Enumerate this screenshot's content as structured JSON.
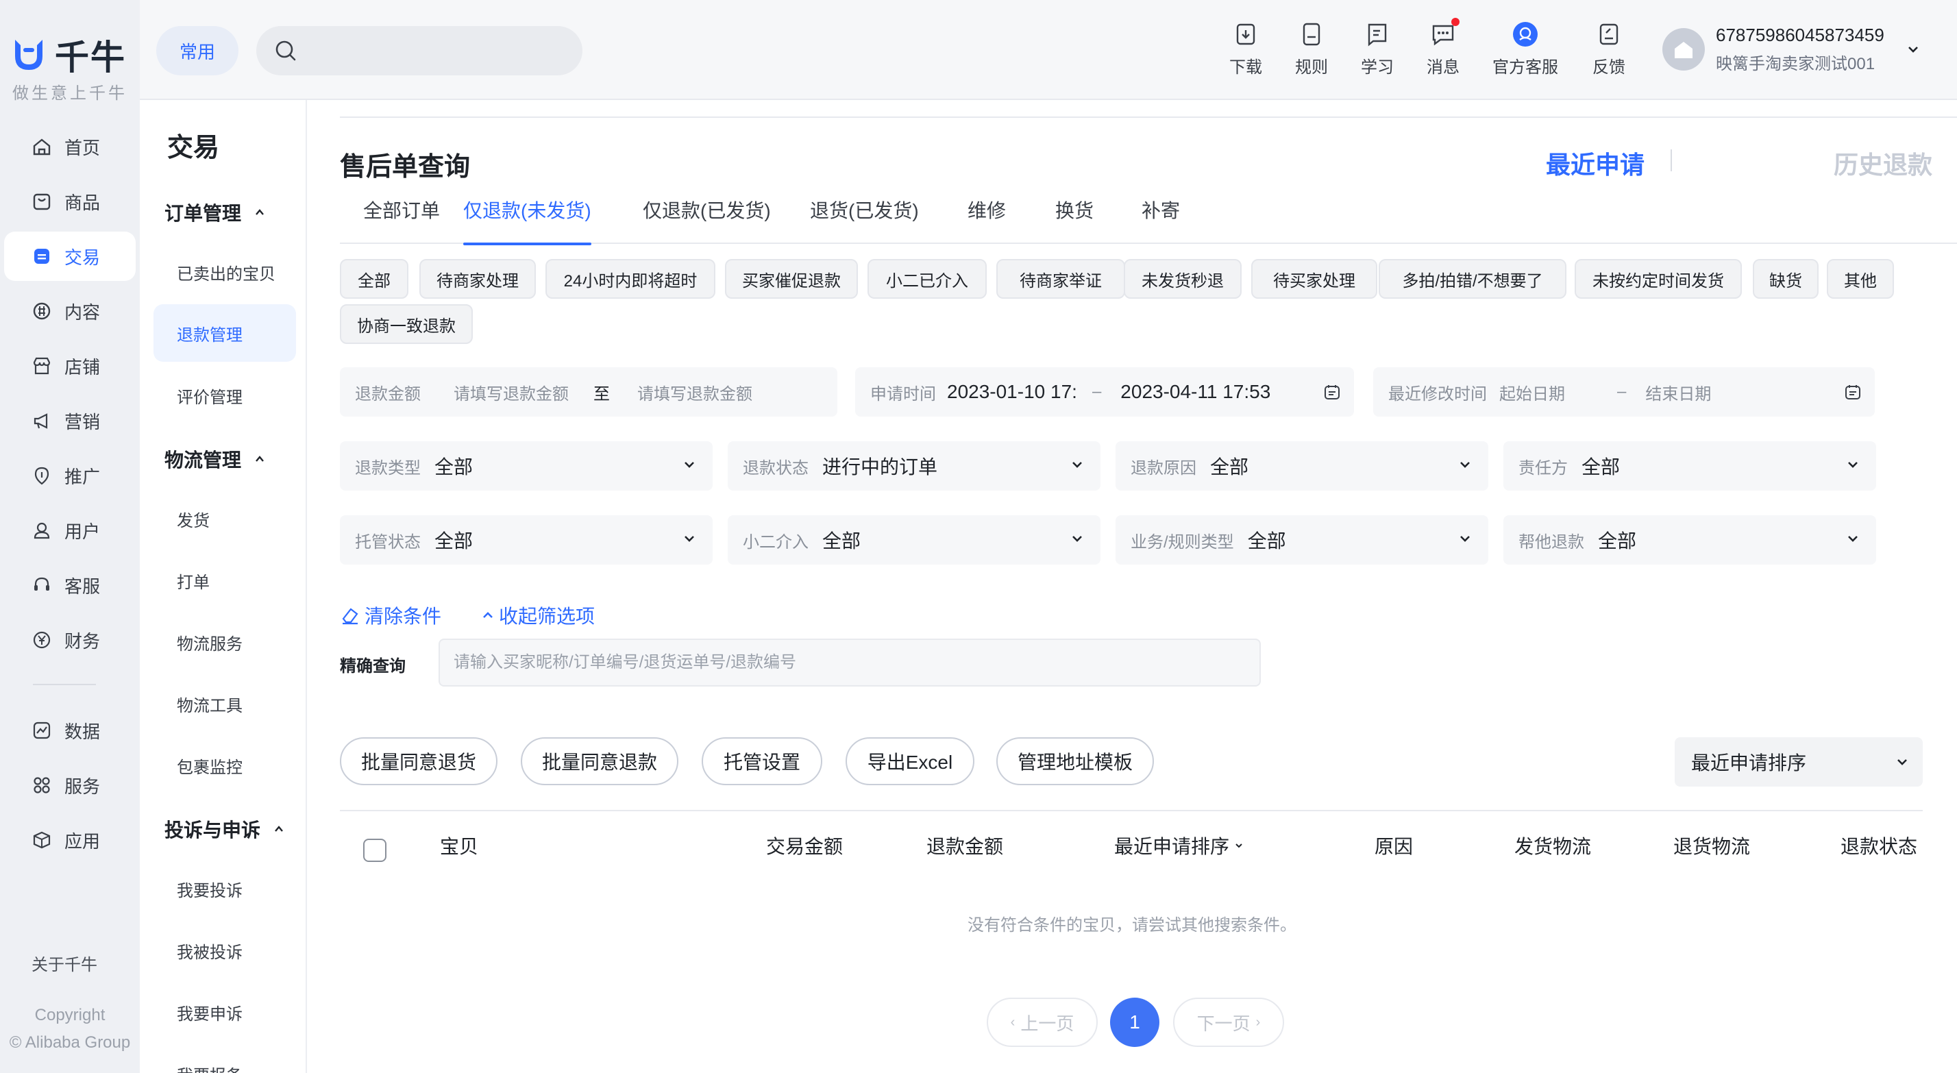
{
  "brand": {
    "name": "千牛",
    "slogan": "做生意上千牛",
    "color": "#2f6bff"
  },
  "rail": {
    "items": [
      {
        "label": "首页",
        "icon": "home-icon"
      },
      {
        "label": "商品",
        "icon": "goods-icon"
      },
      {
        "label": "交易",
        "icon": "trade-icon"
      },
      {
        "label": "内容",
        "icon": "content-icon"
      },
      {
        "label": "店铺",
        "icon": "store-icon"
      },
      {
        "label": "营销",
        "icon": "megaphone-icon"
      },
      {
        "label": "推广",
        "icon": "promote-icon"
      },
      {
        "label": "用户",
        "icon": "user-icon"
      },
      {
        "label": "客服",
        "icon": "headset-icon"
      },
      {
        "label": "财务",
        "icon": "yuan-icon"
      },
      {
        "label": "数据",
        "icon": "chart-icon"
      },
      {
        "label": "服务",
        "icon": "grid-icon"
      },
      {
        "label": "应用",
        "icon": "box-icon"
      }
    ],
    "about": "关于千牛",
    "copyright_1": "Copyright",
    "copyright_2": "© Alibaba Group"
  },
  "subnav": {
    "title": "交易",
    "group_orders": "订单管理",
    "item_sold": "已卖出的宝贝",
    "item_refund": "退款管理",
    "item_review": "评价管理",
    "group_logistics": "物流管理",
    "item_ship": "发货",
    "item_print": "打单",
    "item_logistics_service": "物流服务",
    "item_logistics_tool": "物流工具",
    "item_parcel": "包裹监控",
    "group_complaint": "投诉与申诉",
    "item_complain": "我要投诉",
    "item_complained": "我被投诉",
    "item_appeal": "我要申诉",
    "item_report": "我要报备"
  },
  "topbar": {
    "common_label": "常用",
    "search_placeholder": "",
    "tools": [
      {
        "label": "下载",
        "icon": "download-icon"
      },
      {
        "label": "规则",
        "icon": "rules-icon"
      },
      {
        "label": "学习",
        "icon": "learn-icon"
      },
      {
        "label": "消息",
        "icon": "message-icon"
      },
      {
        "label": "官方客服",
        "icon": "support-icon"
      },
      {
        "label": "反馈",
        "icon": "feedback-icon"
      }
    ],
    "user_id": "67875986045873459",
    "user_shop": "映篱手淘卖家测试001"
  },
  "main": {
    "title": "售后单查询",
    "recent_link": "最近申请",
    "history_link": "历史退款",
    "tabs": [
      "全部订单",
      "仅退款(未发货)",
      "仅退款(已发货)",
      "退货(已发货)",
      "维修",
      "换货",
      "补寄"
    ],
    "active_tab": "仅退款(未发货)",
    "chips": [
      "全部",
      "待商家处理",
      "24小时内即将超时",
      "买家催促退款",
      "小二已介入",
      "待商家举证",
      "未发货秒退",
      "待买家处理",
      "多拍/拍错/不想要了",
      "未按约定时间发货",
      "缺货",
      "其他",
      "协商一致退款"
    ],
    "refund_amount_label": "退款金额",
    "refund_amount_min_placeholder": "请填写退款金额",
    "refund_amount_to": "至",
    "refund_amount_max_placeholder": "请填写退款金额",
    "apply_time_label": "申请时间",
    "apply_time_start": "2023-01-10 17:",
    "apply_time_sep": "–",
    "apply_time_end": "2023-04-11 17:53",
    "modify_time_label": "最近修改时间",
    "modify_time_start": "起始日期",
    "modify_time_sep": "–",
    "modify_time_end": "结束日期",
    "selects": [
      {
        "label": "退款类型",
        "value": "全部"
      },
      {
        "label": "退款状态",
        "value": "进行中的订单"
      },
      {
        "label": "退款原因",
        "value": "全部"
      },
      {
        "label": "责任方",
        "value": "全部"
      },
      {
        "label": "托管状态",
        "value": "全部"
      },
      {
        "label": "小二介入",
        "value": "全部"
      },
      {
        "label": "业务/规则类型",
        "value": "全部"
      },
      {
        "label": "帮他退款",
        "value": "全部"
      }
    ],
    "clear_label": "清除条件",
    "collapse_label": "收起筛选项",
    "exact_label": "精确查询",
    "exact_placeholder": "请输入买家昵称/订单编号/退货运单号/退款编号",
    "buttons": [
      "批量同意退货",
      "批量同意退款",
      "托管设置",
      "导出Excel",
      "管理地址模板"
    ],
    "sort_value": "最近申请排序",
    "columns": [
      "宝贝",
      "交易金额",
      "退款金额",
      "最近申请排序",
      "原因",
      "发货物流",
      "退货物流",
      "退款状态"
    ],
    "empty_message": "没有符合条件的宝贝，请尝试其他搜索条件。",
    "pager_prev": "上一页",
    "pager_current": "1",
    "pager_next": "下一页"
  }
}
